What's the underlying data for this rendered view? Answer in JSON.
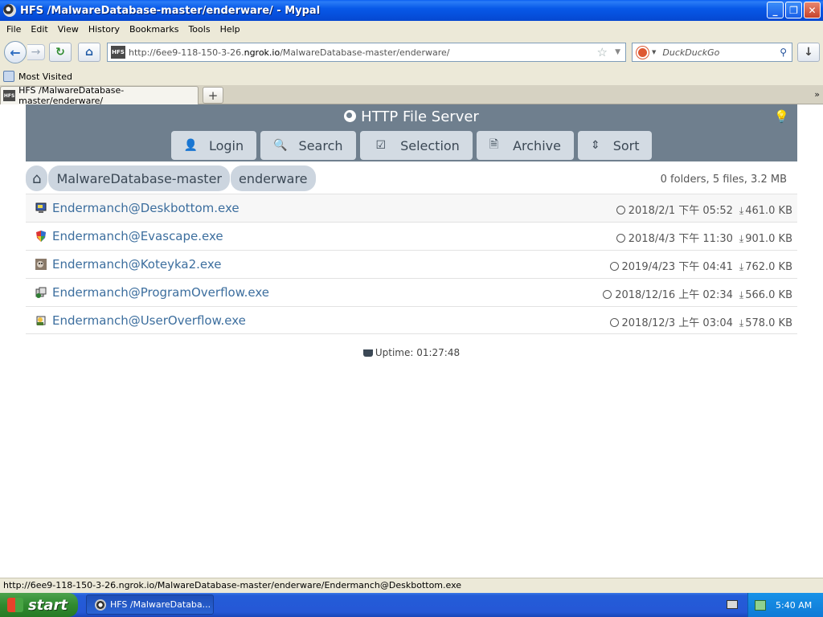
{
  "window": {
    "title": "HFS /MalwareDatabase-master/enderware/ - Mypal",
    "buttons": {
      "minimize": "_",
      "maximize": "❐",
      "close": "✕"
    }
  },
  "menu": [
    "File",
    "Edit",
    "View",
    "History",
    "Bookmarks",
    "Tools",
    "Help"
  ],
  "nav": {
    "url_prefix": "http://6ee9-118-150-3-26.",
    "url_domain": "ngrok.io",
    "url_path": "/MalwareDatabase-master/enderware/",
    "search_placeholder": "DuckDuckGo"
  },
  "bookmarks": {
    "most_visited": "Most Visited"
  },
  "tabs": [
    {
      "label": "HFS /MalwareDatabase-master/enderware/"
    }
  ],
  "page": {
    "title": "HTTP File Server",
    "buttons": [
      {
        "label": "Login",
        "icon": "user-icon"
      },
      {
        "label": "Search",
        "icon": "search-icon"
      },
      {
        "label": "Selection",
        "icon": "checkbox-icon"
      },
      {
        "label": "Archive",
        "icon": "archive-icon"
      },
      {
        "label": "Sort",
        "icon": "sort-icon"
      }
    ],
    "breadcrumb": [
      "MalwareDatabase-master",
      "enderware"
    ],
    "summary": "0 folders, 5 files, 3.2 MB",
    "files": [
      {
        "name": "Endermanch@Deskbottom.exe",
        "date": "2018/2/1 下午 05:52",
        "size": "461.0 KB",
        "icon": "monitor-icon"
      },
      {
        "name": "Endermanch@Evascape.exe",
        "date": "2018/4/3 下午 11:30",
        "size": "901.0 KB",
        "icon": "shield-icon"
      },
      {
        "name": "Endermanch@Koteyka2.exe",
        "date": "2019/4/23 下午 04:41",
        "size": "762.0 KB",
        "icon": "cat-icon"
      },
      {
        "name": "Endermanch@ProgramOverflow.exe",
        "date": "2018/12/16 上午 02:34",
        "size": "566.0 KB",
        "icon": "setup-icon"
      },
      {
        "name": "Endermanch@UserOverflow.exe",
        "date": "2018/12/3 上午 03:04",
        "size": "578.0 KB",
        "icon": "setup-user-icon"
      }
    ],
    "uptime": "Uptime: 01:27:48"
  },
  "status": "http://6ee9-118-150-3-26.ngrok.io/MalwareDatabase-master/enderware/Endermanch@Deskbottom.exe",
  "taskbar": {
    "start": "start",
    "task": "HFS /MalwareDataba...",
    "clock": "5:40 AM"
  }
}
